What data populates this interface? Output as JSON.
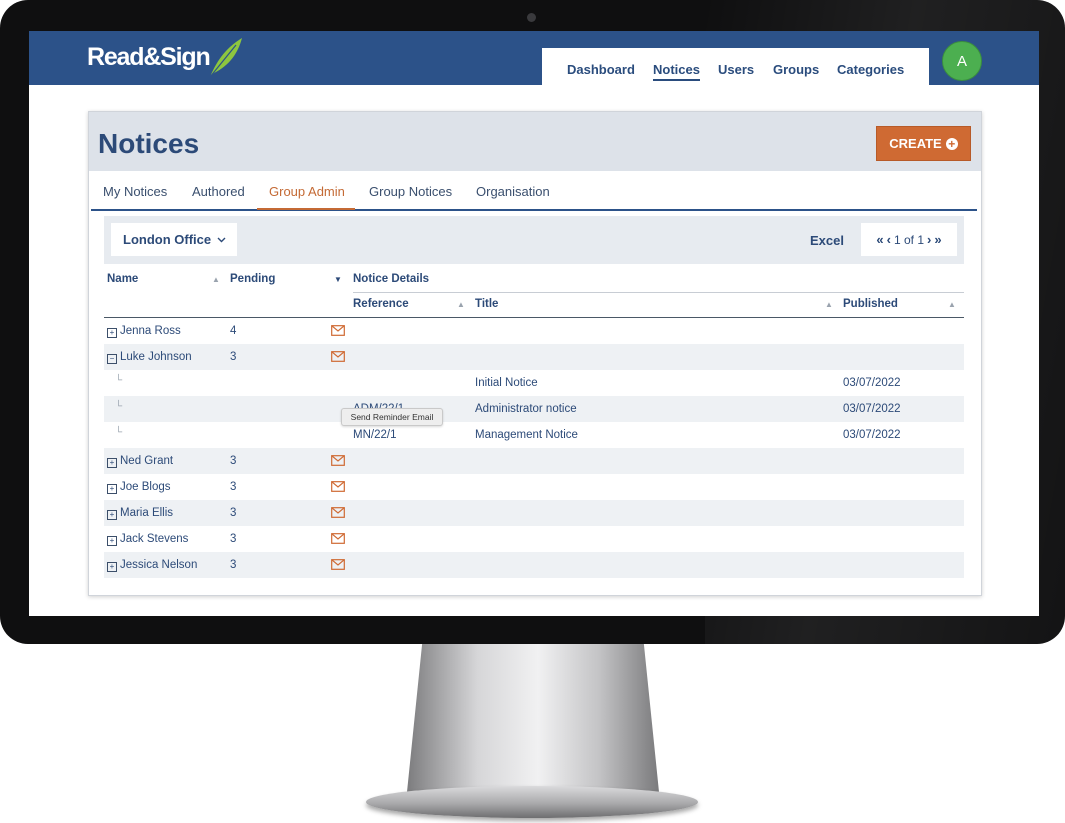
{
  "app": {
    "logo": "Read&Sign",
    "nav": [
      "Dashboard",
      "Notices",
      "Users",
      "Groups",
      "Categories"
    ],
    "active_nav": "Notices",
    "avatar": "A"
  },
  "page": {
    "title": "Notices",
    "create_label": "CREATE",
    "tabs": [
      "My Notices",
      "Authored",
      "Group Admin",
      "Group Notices",
      "Organisation"
    ],
    "active_tab": "Group Admin"
  },
  "toolbar": {
    "office": "London Office",
    "excel": "Excel",
    "pager": {
      "first": "«",
      "prev": "‹",
      "text": "1 of 1",
      "next": "›",
      "last": "»"
    }
  },
  "table": {
    "headers": {
      "name": "Name",
      "pending": "Pending",
      "notice_details": "Notice Details",
      "reference": "Reference",
      "title": "Title",
      "published": "Published"
    },
    "rows": [
      {
        "type": "parent",
        "expander": "⊞",
        "name": "Jenna Ross",
        "pending": "4"
      },
      {
        "type": "parent",
        "expander": "⊟",
        "name": "Luke Johnson",
        "pending": "3"
      },
      {
        "type": "child",
        "reference": "",
        "title": "Initial Notice",
        "published": "03/07/2022"
      },
      {
        "type": "child",
        "reference": "ADM/22/1",
        "title": "Administrator notice",
        "published": "03/07/2022"
      },
      {
        "type": "child",
        "reference": "MN/22/1",
        "title": "Management Notice",
        "published": "03/07/2022"
      },
      {
        "type": "parent",
        "expander": "⊞",
        "name": "Ned Grant",
        "pending": "3"
      },
      {
        "type": "parent",
        "expander": "⊞",
        "name": "Joe Blogs",
        "pending": "3"
      },
      {
        "type": "parent",
        "expander": "⊞",
        "name": "Maria Ellis",
        "pending": "3"
      },
      {
        "type": "parent",
        "expander": "⊞",
        "name": "Jack Stevens",
        "pending": "3"
      },
      {
        "type": "parent",
        "expander": "⊞",
        "name": "Jessica Nelson",
        "pending": "3"
      }
    ],
    "tooltip": "Send Reminder Email"
  },
  "colors": {
    "header_bg": "#2c5289",
    "accent_orange": "#cf6a33",
    "avatar_green": "#4caf50",
    "text_navy": "#2c4a78"
  }
}
